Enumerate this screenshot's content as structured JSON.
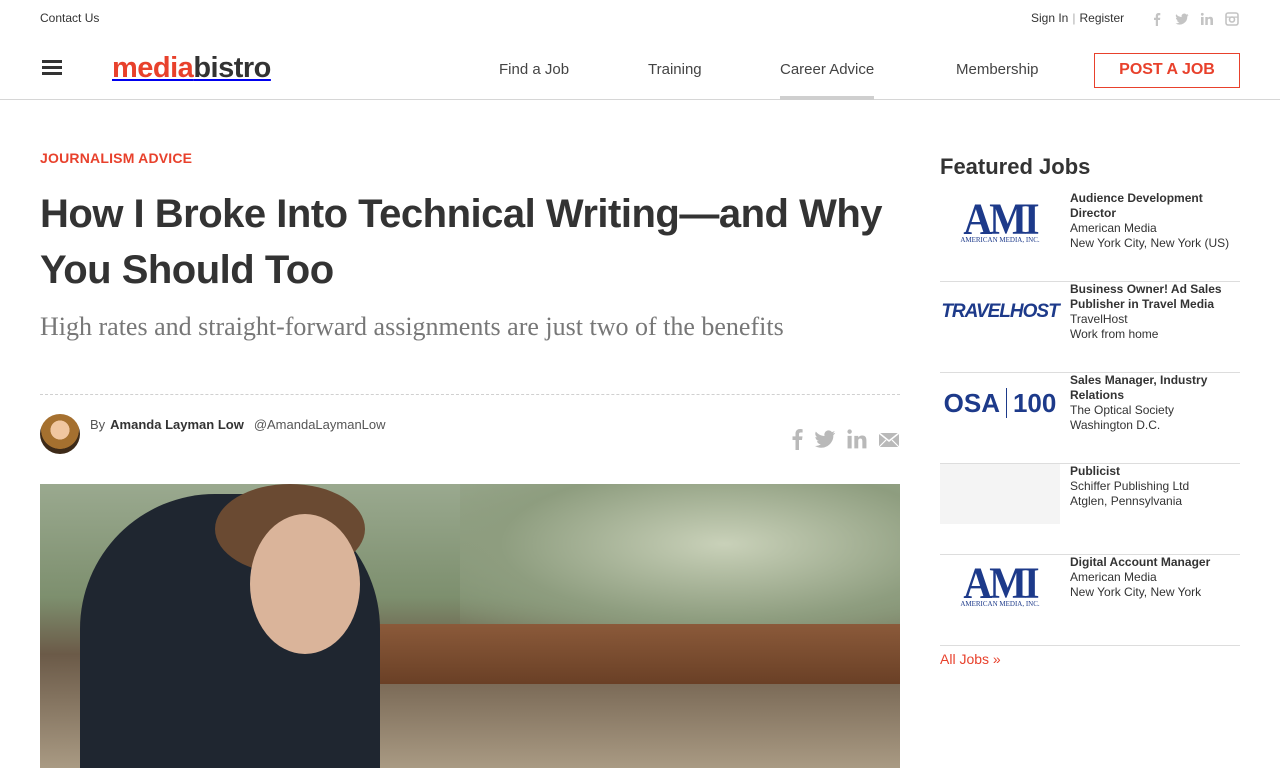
{
  "utility": {
    "contact": "Contact Us",
    "sign_in": "Sign In",
    "separator": "|",
    "register": "Register",
    "social": [
      "facebook-icon",
      "twitter-icon",
      "linkedin-icon",
      "instagram-icon"
    ]
  },
  "header": {
    "logo_a": "media",
    "logo_b": "bistro",
    "nav": [
      {
        "label": "Find a Job",
        "active": false
      },
      {
        "label": "Training",
        "active": false
      },
      {
        "label": "Career Advice",
        "active": true
      },
      {
        "label": "Membership",
        "active": false
      }
    ],
    "post_job": "POST A JOB"
  },
  "article": {
    "category": "JOURNALISM ADVICE",
    "title": "How I Broke Into Technical Writing—and Why You Should Too",
    "dek": "High rates and straight-forward assignments are just two of the benefits",
    "by": "By",
    "author": "Amanda Layman Low",
    "handle": "@AmandaLaymanLow",
    "share": [
      "facebook-icon",
      "twitter-icon",
      "linkedin-icon",
      "email-icon"
    ]
  },
  "sidebar": {
    "title": "Featured Jobs",
    "jobs": [
      {
        "title": "Audience Development Director",
        "company": "American Media",
        "location": "New York City, New York (US)",
        "logo": "AMI",
        "logo_sub": "AMERICAN MEDIA, INC."
      },
      {
        "title": "Business Owner! Ad Sales Publisher in Travel Media",
        "company": "TravelHost",
        "location": "Work from home",
        "logo": "TRAVELHOST"
      },
      {
        "title": "Sales Manager, Industry Relations",
        "company": "The Optical Society",
        "location": "Washington D.C.",
        "logo": "OSA",
        "logo_b": "100"
      },
      {
        "title": "Publicist",
        "company": "Schiffer Publishing Ltd",
        "location": "Atglen, Pennsylvania",
        "logo": ""
      },
      {
        "title": "Digital Account Manager",
        "company": "American Media",
        "location": "New York City, New York",
        "logo": "AMI",
        "logo_sub": "AMERICAN MEDIA, INC."
      }
    ],
    "all_jobs": "All Jobs »"
  },
  "colors": {
    "accent": "#e8412c",
    "text": "#333333",
    "muted": "#777777"
  }
}
